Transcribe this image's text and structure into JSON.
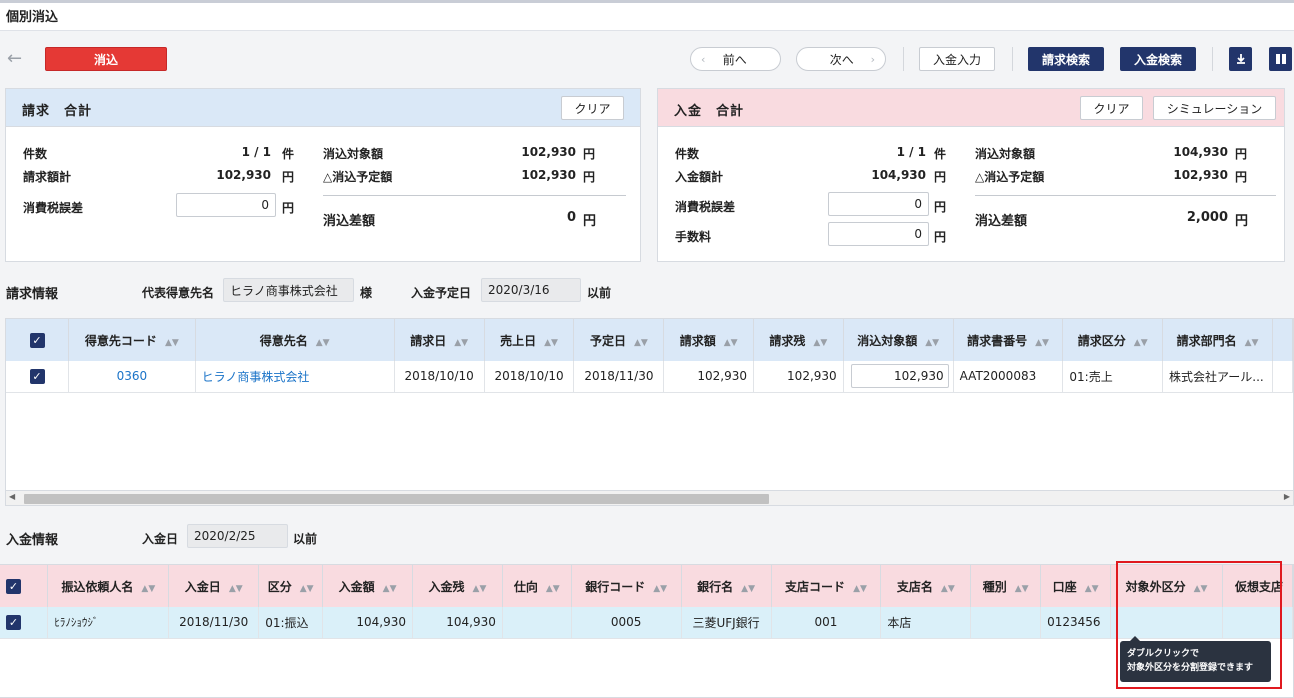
{
  "page": {
    "title": "個別消込"
  },
  "toolbar": {
    "back_icon": "arrow-left-icon",
    "reconcile_label": "消込",
    "prev_label": "前へ",
    "next_label": "次へ",
    "payment_entry_label": "入金入力",
    "invoice_search_label": "請求検索",
    "payment_search_label": "入金検索",
    "download_icon": "download-icon",
    "layout_icon": "columns-icon",
    "accent_color": "#e53935",
    "navy_color": "#22356b"
  },
  "invoice_summary": {
    "title": "請求　合計",
    "clear_label": "クリア",
    "count_label": "件数",
    "count_value": "1 / 1",
    "count_unit": "件",
    "total_label": "請求額計",
    "total_value": "102,930",
    "total_unit": "円",
    "tax_diff_label": "消費税誤差",
    "tax_diff_value": "0",
    "tax_diff_unit": "円",
    "target_label": "消込対象額",
    "target_value": "102,930",
    "target_unit": "円",
    "planned_label": "△消込予定額",
    "planned_value": "102,930",
    "planned_unit": "円",
    "diff_label": "消込差額",
    "diff_value": "0",
    "diff_unit": "円"
  },
  "payment_summary": {
    "title": "入金　合計",
    "clear_label": "クリア",
    "simulation_label": "シミュレーション",
    "count_label": "件数",
    "count_value": "1 / 1",
    "count_unit": "件",
    "total_label": "入金額計",
    "total_value": "104,930",
    "total_unit": "円",
    "tax_diff_label": "消費税誤差",
    "tax_diff_value": "0",
    "tax_diff_unit": "円",
    "fee_label": "手数料",
    "fee_value": "0",
    "fee_unit": "円",
    "target_label": "消込対象額",
    "target_value": "104,930",
    "target_unit": "円",
    "planned_label": "△消込予定額",
    "planned_value": "102,930",
    "planned_unit": "円",
    "diff_label": "消込差額",
    "diff_value": "2,000",
    "diff_unit": "円"
  },
  "invoice_info": {
    "title": "請求情報",
    "customer_label": "代表得意先名",
    "customer_value": "ヒラノ商事株式会社",
    "customer_suffix": "様",
    "due_label": "入金予定日",
    "due_value": "2020/3/16",
    "due_suffix": "以前",
    "columns": [
      "得意先コード",
      "得意先名",
      "請求日",
      "売上日",
      "予定日",
      "請求額",
      "請求残",
      "消込対象額",
      "請求書番号",
      "請求区分",
      "請求部門名"
    ],
    "rows": [
      {
        "code": "0360",
        "name": "ヒラノ商事株式会社",
        "invoice_date": "2018/10/10",
        "sales_date": "2018/10/10",
        "due_date": "2018/11/30",
        "amount": "102,930",
        "remaining": "102,930",
        "target": "102,930",
        "invoice_no": "AAT2000083",
        "category": "01:売上",
        "dept": "株式会社アール..."
      }
    ]
  },
  "payment_info": {
    "title": "入金情報",
    "date_label": "入金日",
    "date_value": "2020/2/25",
    "date_suffix": "以前",
    "columns": [
      "振込依頼人名",
      "入金日",
      "区分",
      "入金額",
      "入金残",
      "仕向",
      "銀行コード",
      "銀行名",
      "支店コード",
      "支店名",
      "種別",
      "口座",
      "対象外区分",
      "仮想支店"
    ],
    "rows": [
      {
        "payer": "ﾋﾗﾉｼｮｳｼﾞ",
        "date": "2018/11/30",
        "category": "01:振込",
        "amount": "104,930",
        "remaining": "104,930",
        "direction": "",
        "bank_code": "0005",
        "bank_name": "三菱UFJ銀行",
        "branch_code": "001",
        "branch_name": "本店",
        "type": "",
        "account": "0123456",
        "excluded": "",
        "virtual": ""
      }
    ],
    "tooltip_line1": "ダブルクリックで",
    "tooltip_line2": "対象外区分を分割登録できます"
  }
}
